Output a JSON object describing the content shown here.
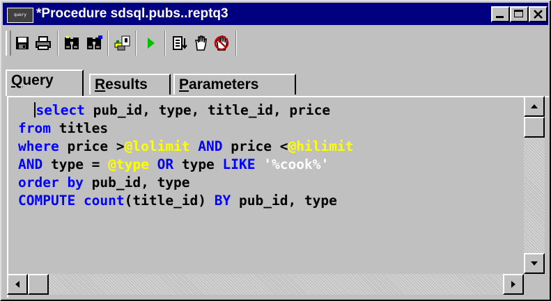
{
  "window": {
    "title": "*Procedure sdsql.pubs..reptq3",
    "icon_label": "query",
    "buttons": [
      "minimize-icon",
      "maximize-icon",
      "close-icon"
    ]
  },
  "toolbar": {
    "icons": [
      "save-icon",
      "print-icon",
      "find-icon",
      "find-next-icon",
      "debug-icon",
      "run-icon",
      "step-icon",
      "breakpoint-icon",
      "clear-breakpoint-icon"
    ]
  },
  "tabs": {
    "query": {
      "mnemonic": "Q",
      "rest": "uery"
    },
    "results": {
      "mnemonic": "R",
      "rest": "esults"
    },
    "parameters": {
      "mnemonic": "P",
      "rest": "arameters"
    },
    "active": "Query"
  },
  "editor": {
    "line1": {
      "indent": "  ",
      "kw1": "select",
      "rest": " pub_id, type, title_id, price"
    },
    "line2": {
      "kw1": "from",
      "rest": " titles"
    },
    "line3": {
      "kw1": "where",
      "t1": " price >",
      "v1": "@lolimit",
      "t2": " ",
      "kw2": "AND",
      "t3": " price <",
      "v2": "@hilimit"
    },
    "line4": {
      "kw1": "AND",
      "t1": " type = ",
      "v1": "@type",
      "t2": " ",
      "kw2": "OR",
      "t3": " type ",
      "kw3": "LIKE",
      "t4": " ",
      "s1": "'%cook%'"
    },
    "line5": {
      "kw1": "order by",
      "rest": " pub_id, type"
    },
    "line6": {
      "kw1": "COMPUTE",
      "t1": " ",
      "kw2": "count",
      "t2": "(title_id) ",
      "kw3": "BY",
      "t3": " pub_id, type"
    }
  },
  "colors": {
    "titlebar": "#000080",
    "keyword": "#0000ff",
    "variable": "#ffff00",
    "string": "#ffffff",
    "background": "#c0c0c0"
  }
}
